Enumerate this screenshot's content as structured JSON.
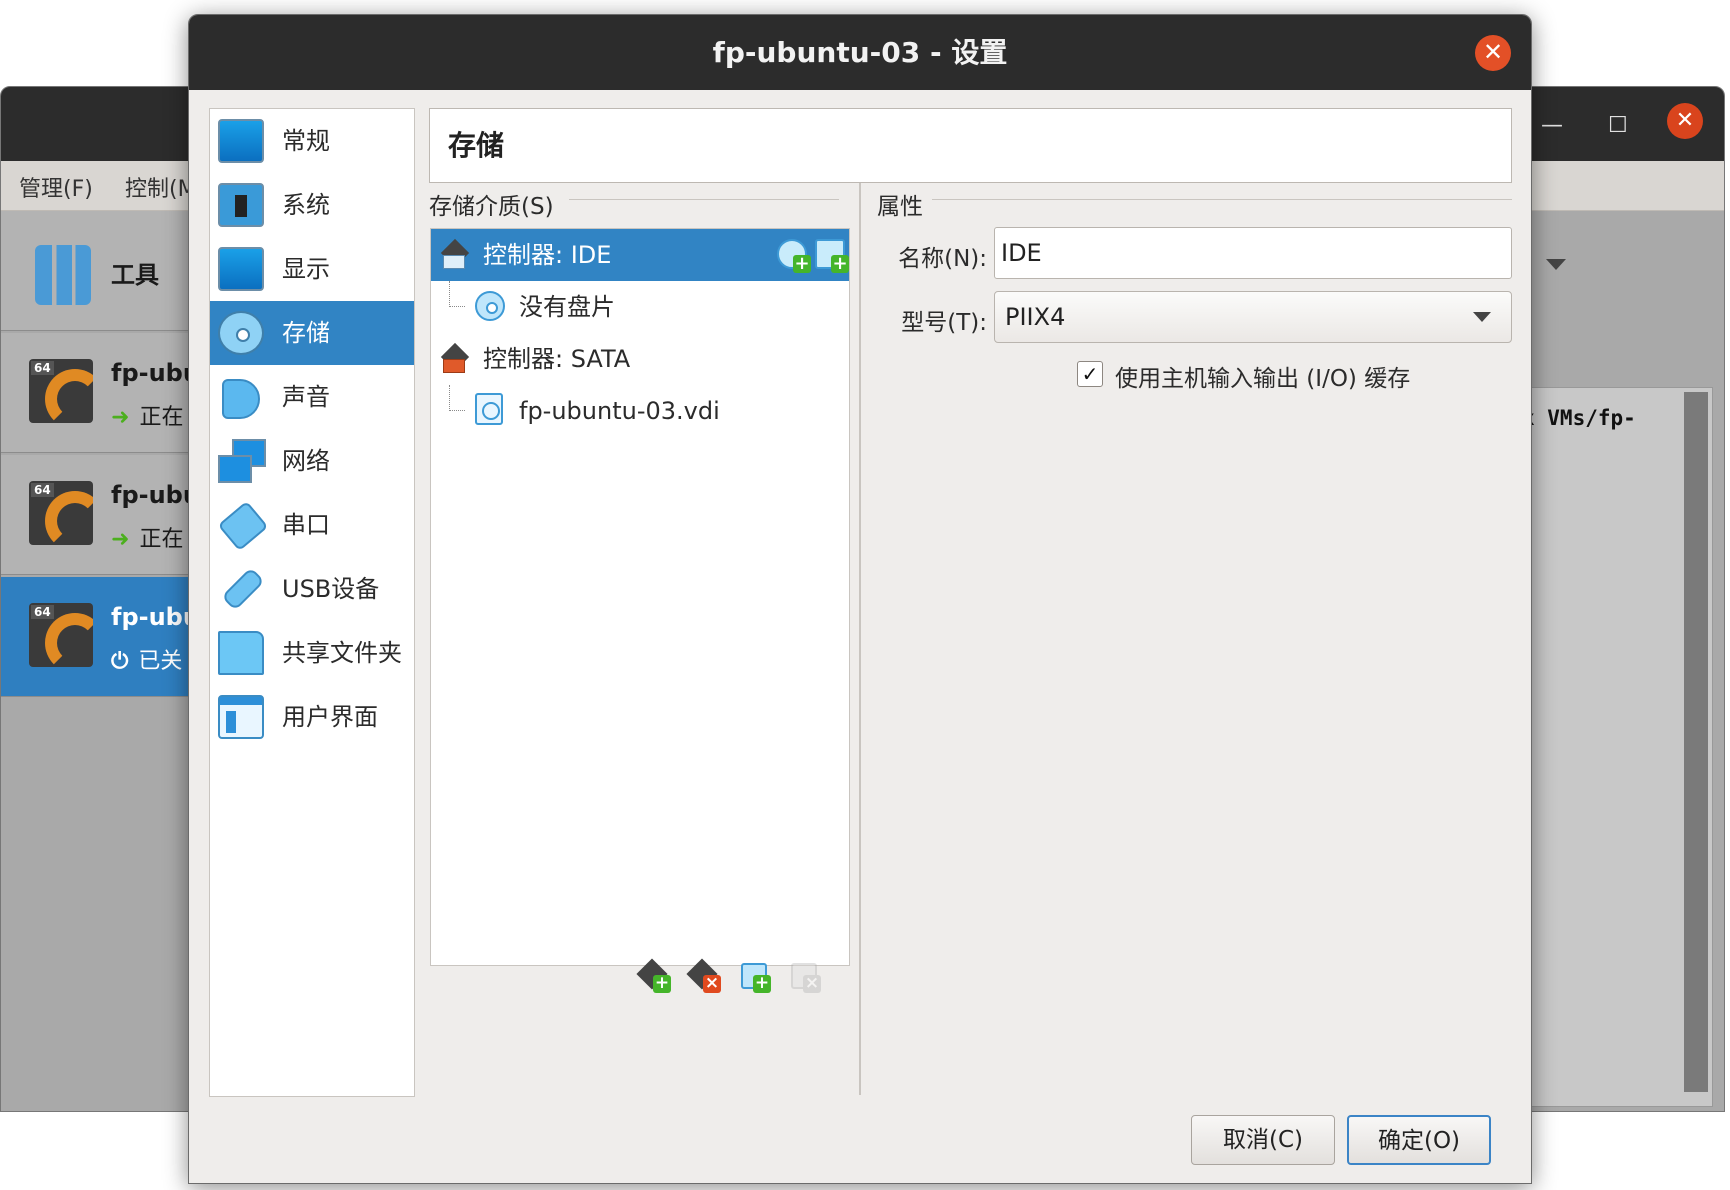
{
  "background_window": {
    "menu": [
      "管理(F)",
      "控制(M"
    ],
    "tools_label": "工具",
    "vms": [
      {
        "name": "fp-ubu",
        "state": "正在",
        "selected": false
      },
      {
        "name": "fp-ubu",
        "state": "正在",
        "selected": false
      },
      {
        "name": "fp-ubu",
        "state": "已关",
        "selected": true
      }
    ],
    "badge_64": "64",
    "console_text": "x VMs/fp-",
    "window_controls": {
      "minimize": "—",
      "maximize": "☐",
      "close": "✕"
    }
  },
  "dialog": {
    "title": "fp-ubuntu-03 - 设置",
    "close_glyph": "✕",
    "categories": [
      {
        "label": "常规",
        "icon": "monitor-icon"
      },
      {
        "label": "系统",
        "icon": "chip-icon"
      },
      {
        "label": "显示",
        "icon": "display-icon"
      },
      {
        "label": "存储",
        "icon": "storage-disk-icon",
        "selected": true
      },
      {
        "label": "声音",
        "icon": "speaker-icon"
      },
      {
        "label": "网络",
        "icon": "network-icon"
      },
      {
        "label": "串口",
        "icon": "serial-port-icon"
      },
      {
        "label": "USB设备",
        "icon": "usb-icon"
      },
      {
        "label": "共享文件夹",
        "icon": "shared-folder-icon"
      },
      {
        "label": "用户界面",
        "icon": "user-interface-icon"
      }
    ],
    "page_title": "存储",
    "storage_media_caption": "存储介质(S)",
    "tree": {
      "controller_ide": "控制器: IDE",
      "empty_drive": "没有盘片",
      "controller_sata": "控制器: SATA",
      "disk": "fp-ubuntu-03.vdi"
    },
    "attributes_caption": "属性",
    "name_label": "名称(N):",
    "name_value": "IDE",
    "type_label": "型号(T):",
    "type_value": "PIIX4",
    "host_io_cache_label": "使用主机输入输出 (I/O) 缓存",
    "host_io_cache_checked": true,
    "checkmark": "✓",
    "cancel_label": "取消(C)",
    "ok_label": "确定(O)",
    "colors": {
      "selection": "#3184c4",
      "titlebar": "#2c2c2c",
      "close": "#e35027",
      "add_green": "#45b52a",
      "remove_red": "#e04a1f"
    }
  }
}
